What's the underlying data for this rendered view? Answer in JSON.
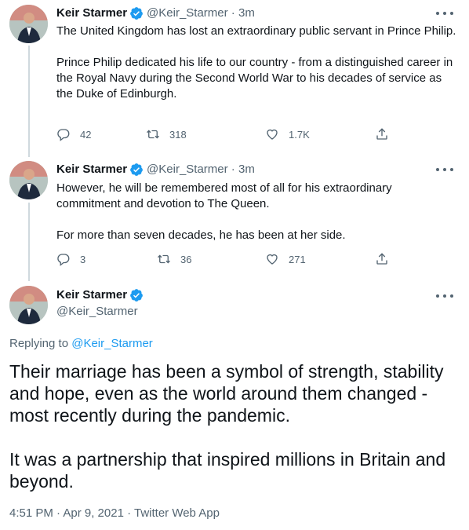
{
  "colors": {
    "accent": "#1d9bf0",
    "text": "#0f1419",
    "muted": "#536471",
    "line": "#cfd9de"
  },
  "tweets": [
    {
      "name": "Keir Starmer",
      "handle": "@Keir_Starmer",
      "time": "3m",
      "paragraphs": [
        "The United Kingdom has lost an extraordinary public servant in Prince Philip.",
        "Prince Philip dedicated his life to our country - from a distinguished career in the Royal Navy during the Second World War to his decades of service as the Duke of Edinburgh."
      ],
      "replies": "42",
      "retweets": "318",
      "likes": "1.7K"
    },
    {
      "name": "Keir Starmer",
      "handle": "@Keir_Starmer",
      "time": "3m",
      "paragraphs": [
        "However, he will be remembered most of all for his extraordinary commitment and devotion to The Queen.",
        "For more than seven decades, he has been at her side."
      ],
      "replies": "3",
      "retweets": "36",
      "likes": "271"
    }
  ],
  "main_tweet": {
    "name": "Keir Starmer",
    "handle": "@Keir_Starmer",
    "replying_prefix": "Replying to ",
    "replying_to": "@Keir_Starmer",
    "paragraphs": [
      "Their marriage has been a symbol of strength, stability and hope, even as the world around them changed - most recently during the pandemic.",
      "It was a partnership that inspired millions in Britain and beyond."
    ],
    "timestamp": "4:51 PM · Apr 9, 2021 · ",
    "source_app": "Twitter Web App"
  },
  "icons": {
    "verified": "verified-badge-icon",
    "reply": "reply-icon",
    "retweet": "retweet-icon",
    "like": "heart-icon",
    "share": "share-icon",
    "more": "more-dots-icon"
  }
}
